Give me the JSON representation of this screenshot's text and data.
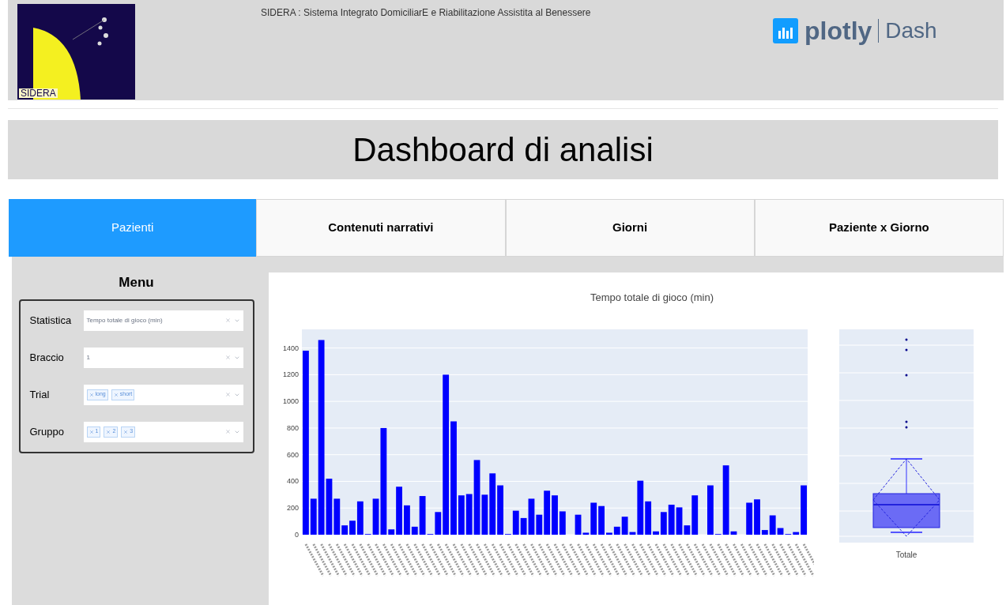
{
  "header": {
    "logo_text": "SIDERA",
    "subtitle": "SIDERA : Sistema Integrato DomiciliarE e Riabilitazione Assistita al Benessere",
    "brand": "plotly",
    "brand_suffix": "Dash"
  },
  "title": "Dashboard di analisi",
  "tabs": [
    {
      "label": "Pazienti",
      "selected": true
    },
    {
      "label": "Contenuti narrativi",
      "selected": false
    },
    {
      "label": "Giorni",
      "selected": false
    },
    {
      "label": "Paziente x Giorno",
      "selected": false
    }
  ],
  "menu": {
    "title": "Menu",
    "fields": [
      {
        "label": "Statistica",
        "kind": "select",
        "value": "Tempo totale di gioco (min)"
      },
      {
        "label": "Braccio",
        "kind": "select",
        "value": "1"
      },
      {
        "label": "Trial",
        "kind": "multi",
        "chips": [
          "long",
          "short"
        ]
      },
      {
        "label": "Gruppo",
        "kind": "multi",
        "chips": [
          "1",
          "2",
          "3"
        ]
      }
    ]
  },
  "chart": {
    "chart_data": {
      "type": "bar",
      "grid": true,
      "title": "Tempo totale di gioco (min)",
      "ylim": [
        0,
        1540
      ],
      "yticks": [
        0,
        200,
        400,
        600,
        800,
        1000,
        1200,
        1400
      ],
      "series": [
        {
          "color": "#0000ff",
          "values": [
            1380,
            270,
            1460,
            420,
            270,
            70,
            105,
            250,
            5,
            270,
            800,
            40,
            360,
            220,
            60,
            290,
            5,
            170,
            1200,
            850,
            295,
            305,
            560,
            300,
            460,
            370,
            5,
            180,
            125,
            270,
            150,
            330,
            295,
            175,
            0,
            150,
            15,
            240,
            215,
            15,
            60,
            135,
            20,
            405,
            250,
            25,
            170,
            225,
            205,
            70,
            295,
            0,
            370,
            5,
            520,
            25,
            0,
            240,
            265,
            35,
            145,
            50,
            5,
            20,
            370
          ]
        }
      ]
    }
  },
  "boxplot": {
    "label": "Totale"
  }
}
